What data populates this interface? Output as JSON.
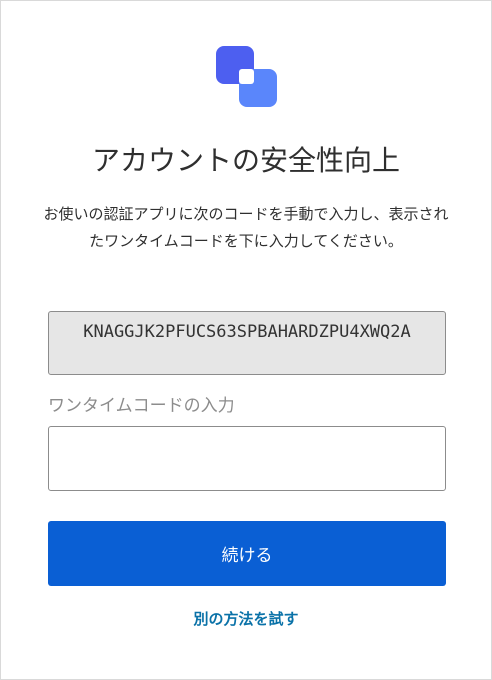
{
  "header": {
    "title": "アカウントの安全性向上",
    "logo_icon": "stacked-squares-logo-icon"
  },
  "instructions": "お使いの認証アプリに次のコードを手動で入力し、表示されたワンタイムコードを下に入力してください。",
  "secret_code": "KNAGGJK2PFUCS63SPBAHARDZPU4XWQ2A",
  "otp": {
    "label": "ワンタイムコードの入力",
    "value": "",
    "placeholder": ""
  },
  "actions": {
    "continue_label": "続ける",
    "alternate_label": "別の方法を試す"
  },
  "colors": {
    "primary": "#0a5fd4",
    "link": "#0a72a8",
    "logo_primary": "#4d6cfa",
    "logo_secondary": "#6b8bff"
  }
}
